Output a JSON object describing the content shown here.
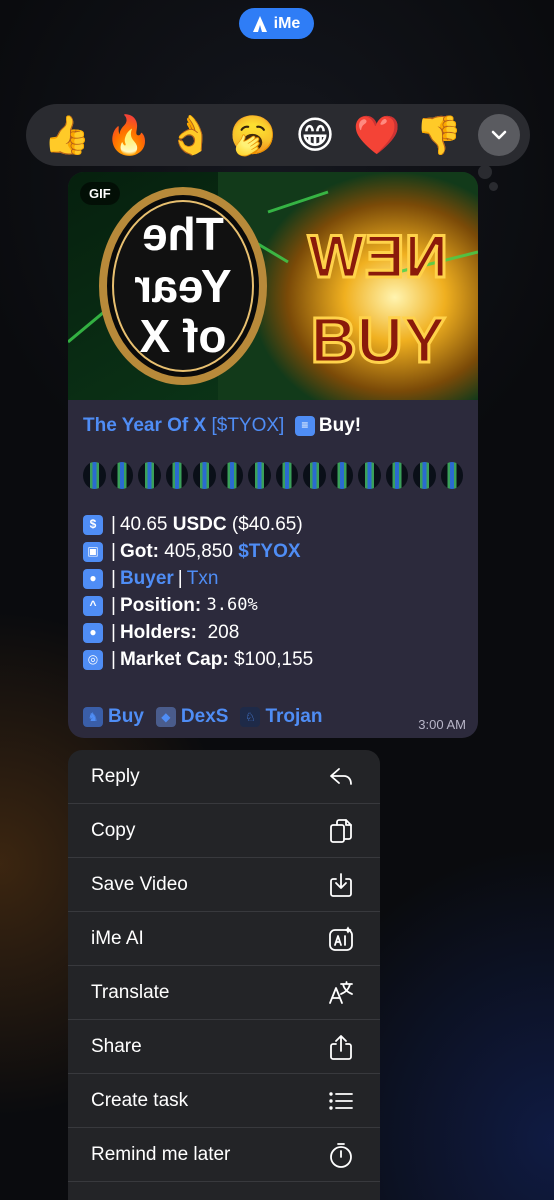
{
  "header": {
    "app_name": "iMe"
  },
  "reactions": [
    "👍",
    "🔥",
    "👌",
    "🥱",
    "😁",
    "❤️",
    "👎"
  ],
  "message": {
    "gif_badge": "GIF",
    "media_text": {
      "left": "The Year of X",
      "right": "NEW BUY"
    },
    "title_name": "The Year Of X",
    "title_ticker": "[$TYOX]",
    "title_action": "Buy!",
    "dots_count": 14,
    "stats": {
      "spent_amount": "40.65",
      "spent_unit": "USDC",
      "spent_usd": "($40.65)",
      "got_label": "Got:",
      "got_amount": "405,850",
      "got_ticker": "$TYOX",
      "buyer_label": "Buyer",
      "txn_label": "Txn",
      "position_label": "Position:",
      "position_value": "3.60%",
      "holders_label": "Holders:",
      "holders_value": "208",
      "mcap_label": "Market Cap:",
      "mcap_value": "$100,155"
    },
    "footer_links": [
      "Buy",
      "DexS",
      "Trojan"
    ],
    "time": "3:00 AM"
  },
  "menu": {
    "items": [
      {
        "label": "Reply",
        "icon": "reply-icon"
      },
      {
        "label": "Copy",
        "icon": "copy-icon"
      },
      {
        "label": "Save Video",
        "icon": "save-icon"
      },
      {
        "label": "iMe AI",
        "icon": "ai-icon"
      },
      {
        "label": "Translate",
        "icon": "translate-icon"
      },
      {
        "label": "Share",
        "icon": "share-icon"
      },
      {
        "label": "Create task",
        "icon": "list-icon"
      },
      {
        "label": "Remind me later",
        "icon": "timer-icon"
      }
    ]
  },
  "colors": {
    "accent": "#4f8df5",
    "pill": "#2f7df6",
    "bubble": "#2c2a3c",
    "menu": "#232427"
  }
}
